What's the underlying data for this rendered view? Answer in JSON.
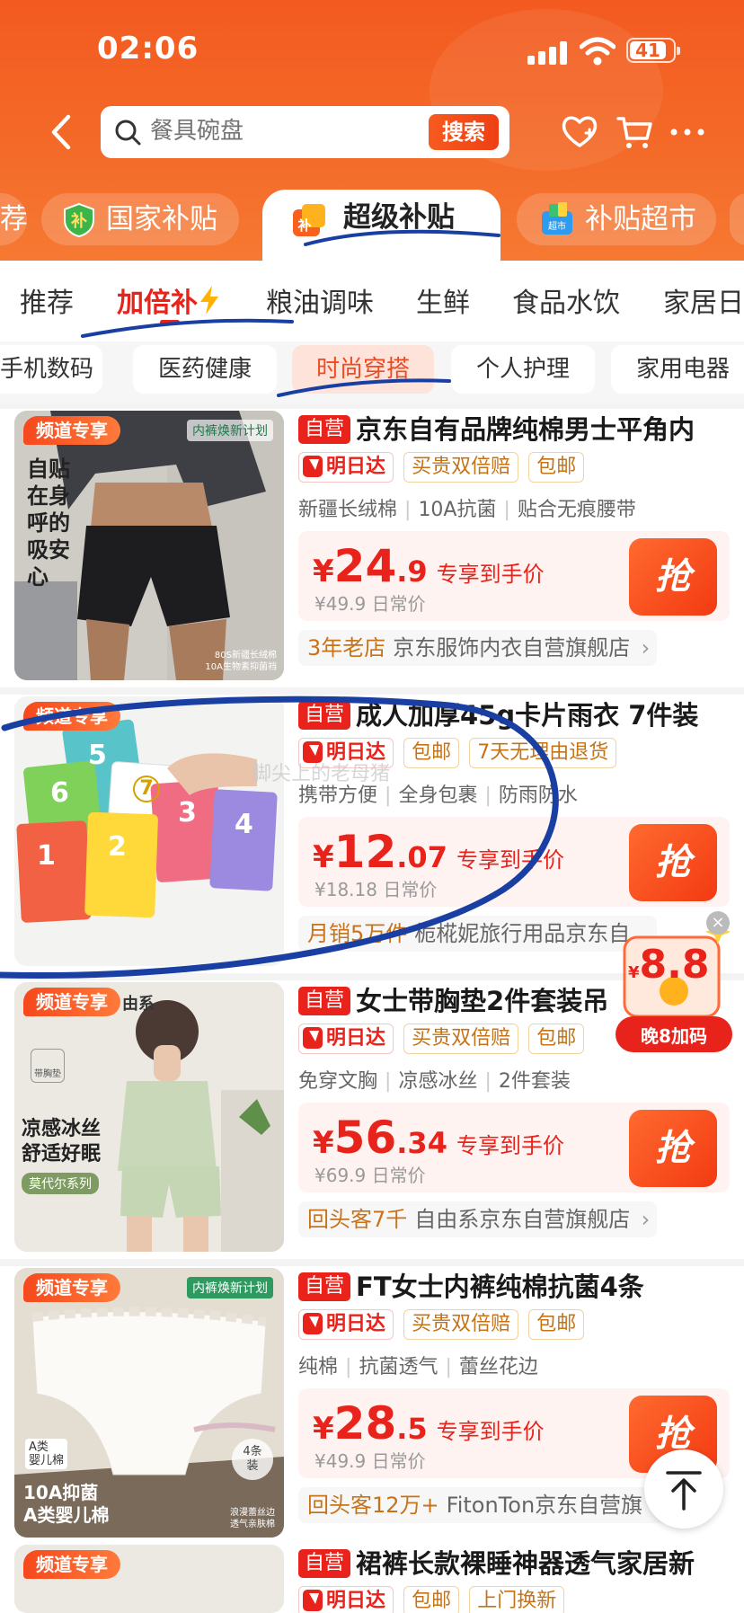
{
  "status_bar": {
    "time": "02:06",
    "battery": "41"
  },
  "search": {
    "placeholder": "餐具碗盘",
    "button": "搜索"
  },
  "channels": [
    {
      "label": "荐"
    },
    {
      "label": "国家补贴"
    },
    {
      "label": "超级补贴"
    },
    {
      "label": "补贴超市"
    }
  ],
  "subnav": [
    "推荐",
    "加倍补",
    "粮油调味",
    "生鲜",
    "食品水饮",
    "家居日"
  ],
  "chips": [
    "手机数码",
    "医药健康",
    "时尚穿搭",
    "个人护理",
    "家用电器"
  ],
  "labels": {
    "self": "自营",
    "fast": "明日达",
    "exclusive": "频道专享",
    "grab": "抢",
    "deal": "专享到手价",
    "currency": "¥"
  },
  "products": [
    {
      "title": "京东自有品牌纯棉男士平角内",
      "badges": [
        "买贵双倍赔",
        "包邮"
      ],
      "features": [
        "新疆长绒棉",
        "10A抗菌",
        "贴合无痕腰带"
      ],
      "price_int": "24",
      "price_dec": ".9",
      "orig": "¥49.9 日常价",
      "store_hl": "3年老店",
      "store": "京东服饰内衣自营旗舰店",
      "img_text": "自贴\n在身\n呼的\n吸安\n心",
      "img_corner": "80S新疆长绒棉\n10A生物素抑菌裆",
      "img_badge": "内裤焕新计划"
    },
    {
      "title": "成人加厚45g卡片雨衣 7件装",
      "badges": [
        "包邮",
        "7天无理由退货"
      ],
      "features": [
        "携带方便",
        "全身包裹",
        "防雨防水"
      ],
      "price_int": "12",
      "price_dec": ".07",
      "orig": "¥18.18 日常价",
      "store_hl": "月销5万件",
      "store": "栀椛妮旅行用品京东自",
      "img_nums": [
        "5",
        "6",
        "7",
        "3",
        "4",
        "1",
        "2"
      ],
      "img_watermark": "脚尖上的老母猪"
    },
    {
      "title": "女士带胸垫2件套装吊",
      "badges": [
        "买贵双倍赔",
        "包邮"
      ],
      "features": [
        "免穿文胸",
        "凉感冰丝",
        "2件套装"
      ],
      "price_int": "56",
      "price_dec": ".34",
      "orig": "¥69.9 日常价",
      "store_hl": "回头客7千",
      "store": "自由系京东自营旗舰店",
      "img_brand": "由系",
      "img_text": "凉感冰丝\n舒适好眠",
      "img_sub": "莫代尔系列",
      "img_pad": "带胸垫"
    },
    {
      "title": "FT女士内裤纯棉抗菌4条",
      "badges": [
        "买贵双倍赔",
        "包邮"
      ],
      "features": [
        "纯棉",
        "抗菌透气",
        "蕾丝花边"
      ],
      "price_int": "28",
      "price_dec": ".5",
      "orig": "¥49.9 日常价",
      "store_hl": "回头客12万+",
      "store": "FitonTon京东自营旗",
      "img_text": "10A抑菌\nA类婴儿棉",
      "img_badge": "内裤焕新计划",
      "img_a": "A类\n婴儿棉",
      "img_count": "4条\n装",
      "img_corner": "浪漫蕾丝边\n透气亲肤棉"
    },
    {
      "title": "裙裤长款裸睡神器透气家居新",
      "badges": [
        "包邮",
        "上门换新"
      ]
    }
  ],
  "float_coupon": {
    "amount": "8.8",
    "label": "晚8加码"
  }
}
